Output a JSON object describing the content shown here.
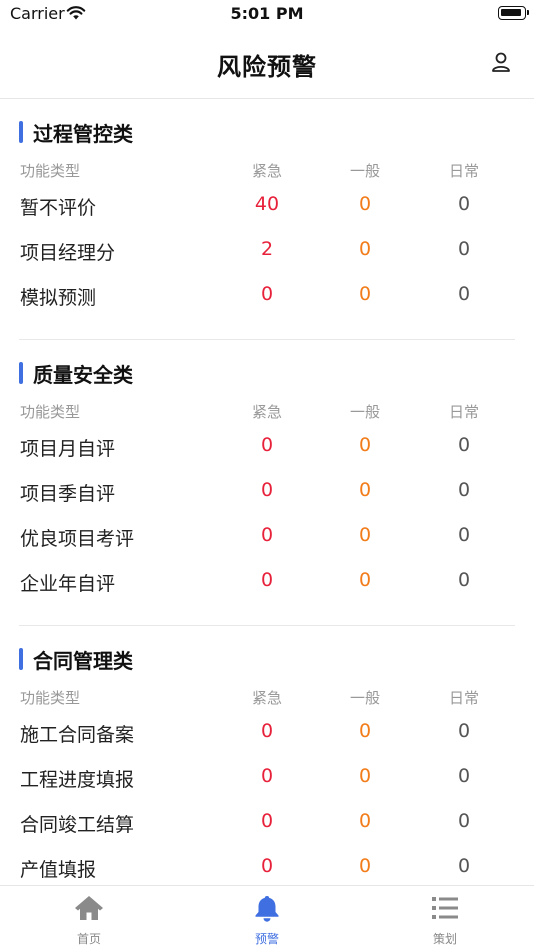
{
  "status_bar": {
    "carrier": "Carrier",
    "time": "5:01 PM"
  },
  "nav": {
    "title": "风险预警",
    "user_icon": "user-icon"
  },
  "columns": {
    "type": "功能类型",
    "urgent": "紧急",
    "normal": "一般",
    "daily": "日常"
  },
  "colors": {
    "accent": "#3f6fe0",
    "urgent": "#e8213b",
    "normal": "#f27c19",
    "daily": "#555555"
  },
  "sections": [
    {
      "title": "过程管控类",
      "rows": [
        {
          "name": "暂不评价",
          "urgent": "40",
          "normal": "0",
          "daily": "0"
        },
        {
          "name": "项目经理分",
          "urgent": "2",
          "normal": "0",
          "daily": "0"
        },
        {
          "name": "模拟预测",
          "urgent": "0",
          "normal": "0",
          "daily": "0"
        }
      ]
    },
    {
      "title": "质量安全类",
      "rows": [
        {
          "name": "项目月自评",
          "urgent": "0",
          "normal": "0",
          "daily": "0"
        },
        {
          "name": "项目季自评",
          "urgent": "0",
          "normal": "0",
          "daily": "0"
        },
        {
          "name": "优良项目考评",
          "urgent": "0",
          "normal": "0",
          "daily": "0"
        },
        {
          "name": "企业年自评",
          "urgent": "0",
          "normal": "0",
          "daily": "0"
        }
      ]
    },
    {
      "title": "合同管理类",
      "rows": [
        {
          "name": "施工合同备案",
          "urgent": "0",
          "normal": "0",
          "daily": "0"
        },
        {
          "name": "工程进度填报",
          "urgent": "0",
          "normal": "0",
          "daily": "0"
        },
        {
          "name": "合同竣工结算",
          "urgent": "0",
          "normal": "0",
          "daily": "0"
        },
        {
          "name": "产值填报",
          "urgent": "0",
          "normal": "0",
          "daily": "0"
        }
      ]
    }
  ],
  "tabs": [
    {
      "label": "首页",
      "icon": "home-icon",
      "active": false
    },
    {
      "label": "预警",
      "icon": "bell-icon",
      "active": true
    },
    {
      "label": "策划",
      "icon": "list-icon",
      "active": false
    }
  ]
}
